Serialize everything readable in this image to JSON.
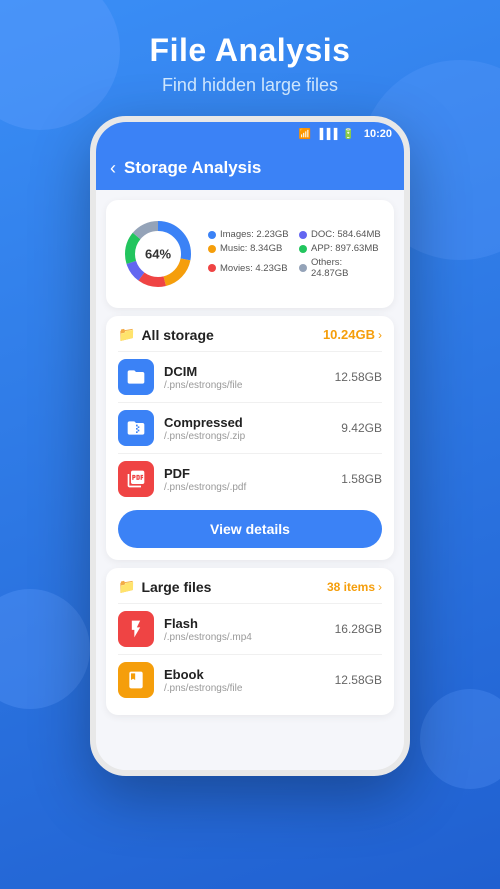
{
  "background": {
    "color": "#2f7cf0"
  },
  "header": {
    "title": "File Analysis",
    "subtitle": "Find hidden large files"
  },
  "status_bar": {
    "time": "10:20"
  },
  "top_bar": {
    "title": "Storage Analysis",
    "back_label": "<"
  },
  "chart": {
    "center_text": "64%",
    "segments": [
      {
        "label": "Images",
        "value": "2.23GB",
        "color": "#3b82f6",
        "percent": 28
      },
      {
        "label": "Music",
        "value": "8.34GB",
        "color": "#f59e0b",
        "percent": 18
      },
      {
        "label": "Movies",
        "value": "4.23GB",
        "color": "#ef4444",
        "percent": 14
      },
      {
        "label": "DOC",
        "value": "584.64MB",
        "color": "#6366f1",
        "percent": 10
      },
      {
        "label": "APP",
        "value": "897.63MB",
        "color": "#22c55e",
        "percent": 16
      },
      {
        "label": "Others",
        "value": "24.87GB",
        "color": "#94a3b8",
        "percent": 14
      }
    ]
  },
  "all_storage": {
    "title": "All storage",
    "icon": "📁",
    "total": "10.24GB",
    "items": [
      {
        "name": "DCIM",
        "path": "/.pns/estrongs/file",
        "size": "12.58GB",
        "icon_type": "blue",
        "icon": "📂"
      },
      {
        "name": "Compressed",
        "path": "/.pns/estrongs/.zip",
        "size": "9.42GB",
        "icon_type": "blue-zip",
        "icon": "📦"
      },
      {
        "name": "PDF",
        "path": "/.pns/estrongs/.pdf",
        "size": "1.58GB",
        "icon_type": "red-pdf",
        "icon": "📄"
      }
    ],
    "view_details_label": "View details"
  },
  "large_files": {
    "title": "Large files",
    "icon": "📁",
    "count": "38 items",
    "items": [
      {
        "name": "Flash",
        "path": "/.pns/estrongs/.mp4",
        "size": "16.28GB",
        "icon_type": "red-flash",
        "icon": "⚡"
      },
      {
        "name": "Ebook",
        "path": "/.pns/estrongs/file",
        "size": "12.58GB",
        "icon_type": "yellow-ebook",
        "icon": "📒"
      }
    ]
  }
}
